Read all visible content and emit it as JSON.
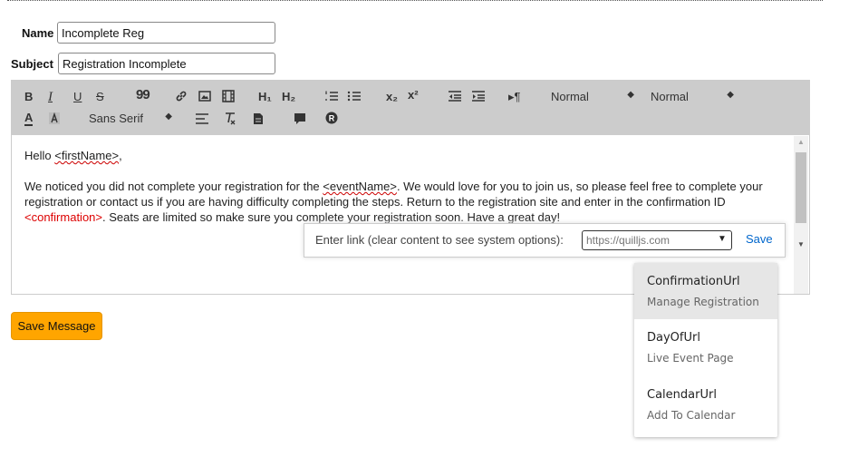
{
  "form": {
    "name_label": "Name",
    "name_value": "Incomplete Reg",
    "subject_label": "Subject",
    "subject_value": "Registration Incomplete"
  },
  "toolbar": {
    "bold": "B",
    "italic": "I",
    "underline": "U",
    "strike": "S",
    "blockquote": "99",
    "h1": "H₁",
    "h2": "H₂",
    "subscript": "x₂",
    "superscript": "x²",
    "direction": "▸¶",
    "size_picker": "Normal",
    "header_picker": "Normal",
    "color": "A",
    "font_picker": "Sans Serif",
    "caret": "◆"
  },
  "editor": {
    "greeting_prefix": "Hello ",
    "greeting_var": "<firstName>",
    "greeting_suffix": ",",
    "p2_a": "We noticed you did not complete your registration for the ",
    "p2_var": "<eventName>",
    "p2_b": ".  We would love for you to join us, so please feel free to complete your registration or contact us if you are having difficulty completing the steps.  Return to the registration site and enter in the confirmation ID ",
    "p2_confirmation": "<confirmation>",
    "p2_c": ".  Seats are limited so make sure you complete your registration soon.  Have a great day!"
  },
  "link_tooltip": {
    "label": "Enter link (clear content to see system options):",
    "placeholder": "https://quilljs.com",
    "save": "Save"
  },
  "suggestions": [
    {
      "name": "ConfirmationUrl",
      "desc": "Manage Registration",
      "active": true
    },
    {
      "name": "DayOfUrl",
      "desc": "Live Event Page",
      "active": false
    },
    {
      "name": "CalendarUrl",
      "desc": "Add To Calendar",
      "active": false
    }
  ],
  "save_button": "Save Message"
}
